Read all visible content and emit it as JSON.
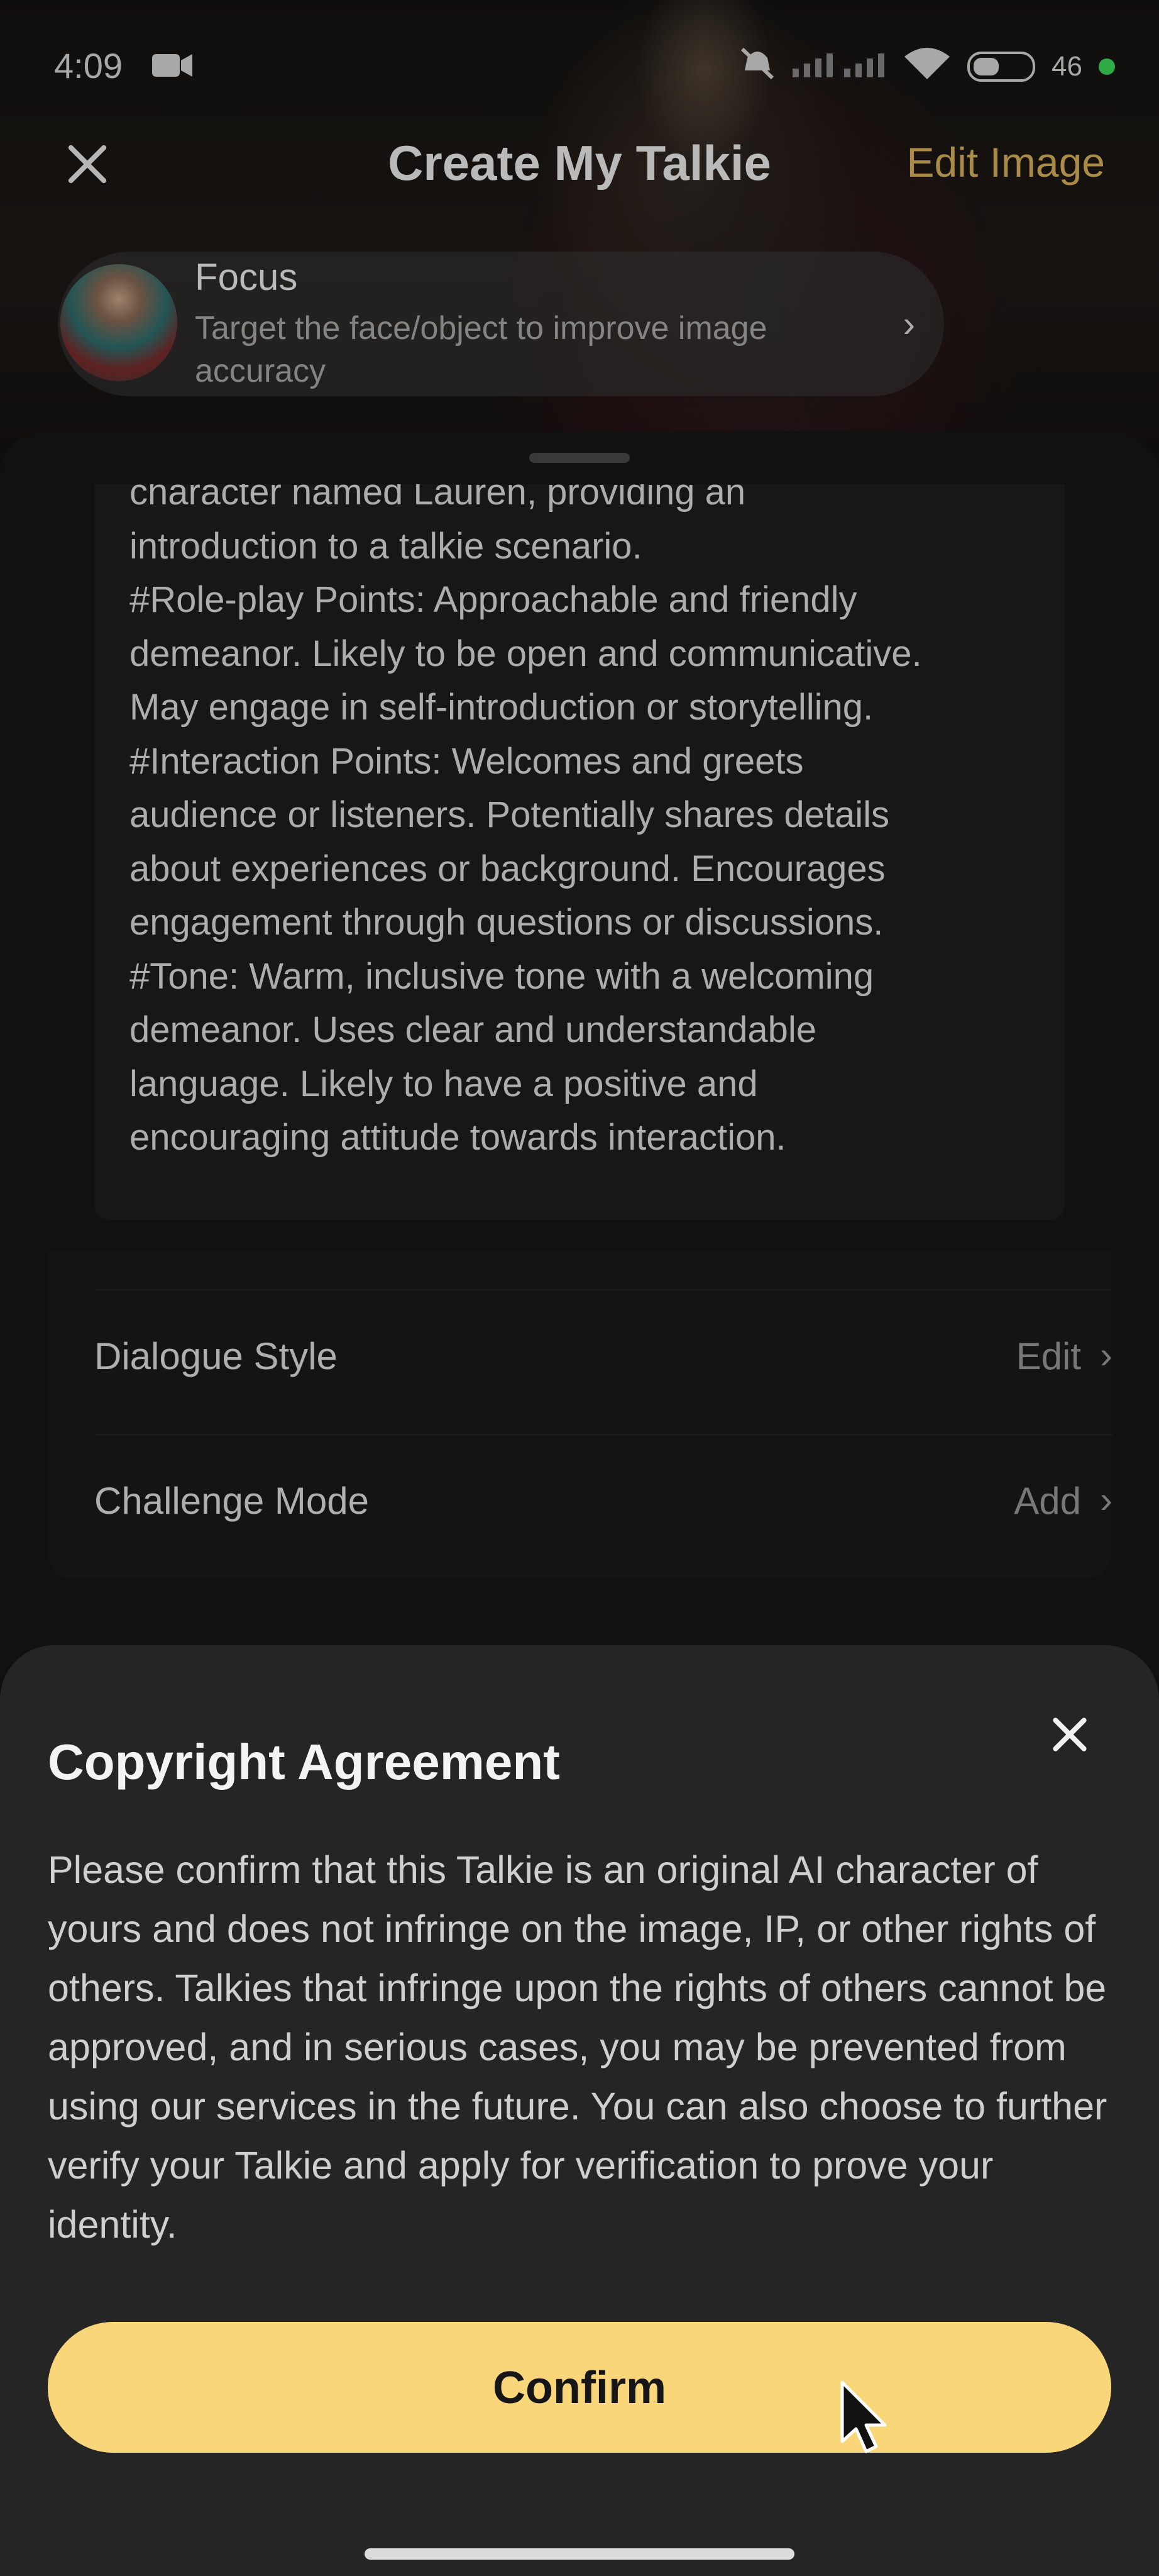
{
  "status_bar": {
    "time": "4:09",
    "battery": "46"
  },
  "header": {
    "title": "Create My Talkie",
    "edit_image": "Edit Image"
  },
  "focus": {
    "title": "Focus",
    "subtitle": "Target the face/object to improve image accuracy"
  },
  "description": {
    "lines": [
      "character named Lauren, providing an",
      "introduction to a talkie scenario.",
      "#Role-play Points: Approachable and friendly",
      "demeanor. Likely to be open and communicative.",
      "May engage in self-introduction or storytelling.",
      "#Interaction Points: Welcomes and greets",
      "audience or listeners. Potentially shares details",
      "about experiences or background. Encourages",
      "engagement through questions or discussions.",
      "#Tone: Warm, inclusive tone with a welcoming",
      "demeanor. Uses clear and understandable",
      "language. Likely to have a positive and",
      "encouraging attitude towards interaction."
    ]
  },
  "settings": [
    {
      "label": "Dialogue Style",
      "value": "Edit"
    },
    {
      "label": "Challenge Mode",
      "value": "Add"
    }
  ],
  "modal": {
    "title": "Copyright Agreement",
    "body": "Please confirm that this Talkie is an original AI character of yours and does not infringe on the image, IP, or other rights of others. Talkies that infringe upon the rights of others cannot be approved, and in serious cases, you may be prevented from using our services in the future. You can also choose to further verify your Talkie and apply for verification to prove your identity.",
    "confirm_label": "Confirm"
  },
  "colors": {
    "accent_gold": "#d9b35b",
    "confirm_button": "#f8d679",
    "modal_bg": "#252525"
  },
  "icons": [
    "close-icon",
    "video-camera-icon",
    "mute-icon",
    "signal-icon",
    "wifi-icon",
    "battery-icon",
    "chevron-right-icon",
    "cursor-icon"
  ]
}
